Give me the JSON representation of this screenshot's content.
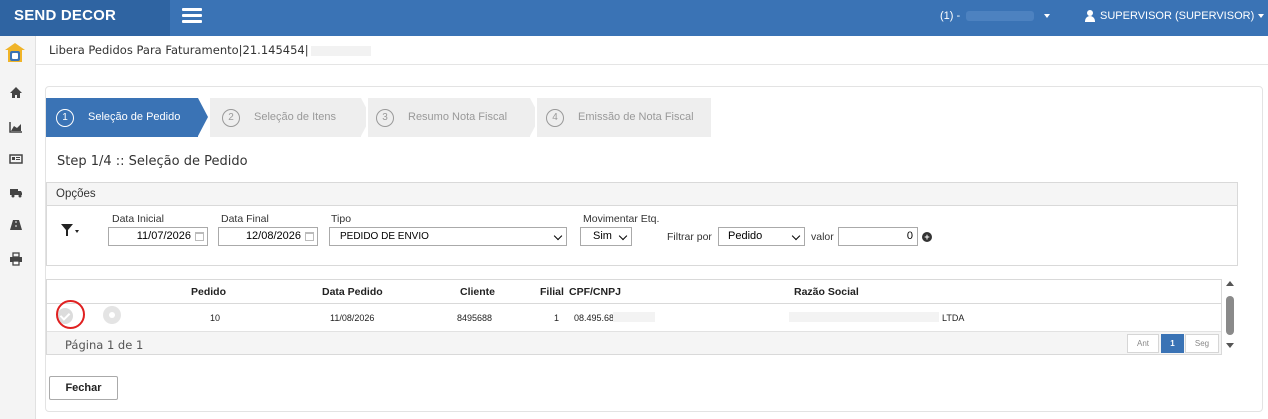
{
  "app": {
    "brand": "SEND DECOR"
  },
  "topbar": {
    "company_label": "(1) -",
    "user_label": "SUPERVISOR (SUPERVISOR)"
  },
  "page": {
    "title": "Libera Pedidos Para Faturamento|21.145454|"
  },
  "wizard": {
    "steps": [
      {
        "num": "1",
        "label": "Seleção de Pedido",
        "active": true
      },
      {
        "num": "2",
        "label": "Seleção de Itens",
        "active": false
      },
      {
        "num": "3",
        "label": "Resumo Nota Fiscal",
        "active": false
      },
      {
        "num": "4",
        "label": "Emissão de Nota Fiscal",
        "active": false
      }
    ]
  },
  "step_heading": "Step 1/4 :: Seleção de Pedido",
  "options": {
    "header": "Opções",
    "data_inicial_label": "Data Inicial",
    "data_inicial_value": "11/07/2026",
    "data_final_label": "Data Final",
    "data_final_value": "12/08/2026",
    "tipo_label": "Tipo",
    "tipo_value": "PEDIDO DE ENVIO",
    "movimentar_label": "Movimentar Etq.",
    "movimentar_value": "Sim",
    "filtrar_label": "Filtrar por",
    "filtrar_value": "Pedido",
    "valor_label": "valor",
    "valor_value": "0"
  },
  "table": {
    "headers": {
      "pedido": "Pedido",
      "data_pedido": "Data Pedido",
      "cliente": "Cliente",
      "filial": "Filial",
      "cpf_cnpj": "CPF/CNPJ",
      "razao_social": "Razão Social"
    },
    "rows": [
      {
        "pedido": "10",
        "data_pedido": "11/08/2026",
        "cliente": "8495688",
        "filial": "1",
        "cpf_cnpj": "08.495.68",
        "razao_social": "LTDA"
      }
    ],
    "page_info": "Página 1 de 1",
    "pager": {
      "prev": "Ant",
      "current": "1",
      "next": "Seg"
    }
  },
  "buttons": {
    "close": "Fechar"
  },
  "colors": {
    "primary": "#3a73b5",
    "brand_bg": "#2f64a2",
    "highlight_ring": "#e02020"
  }
}
